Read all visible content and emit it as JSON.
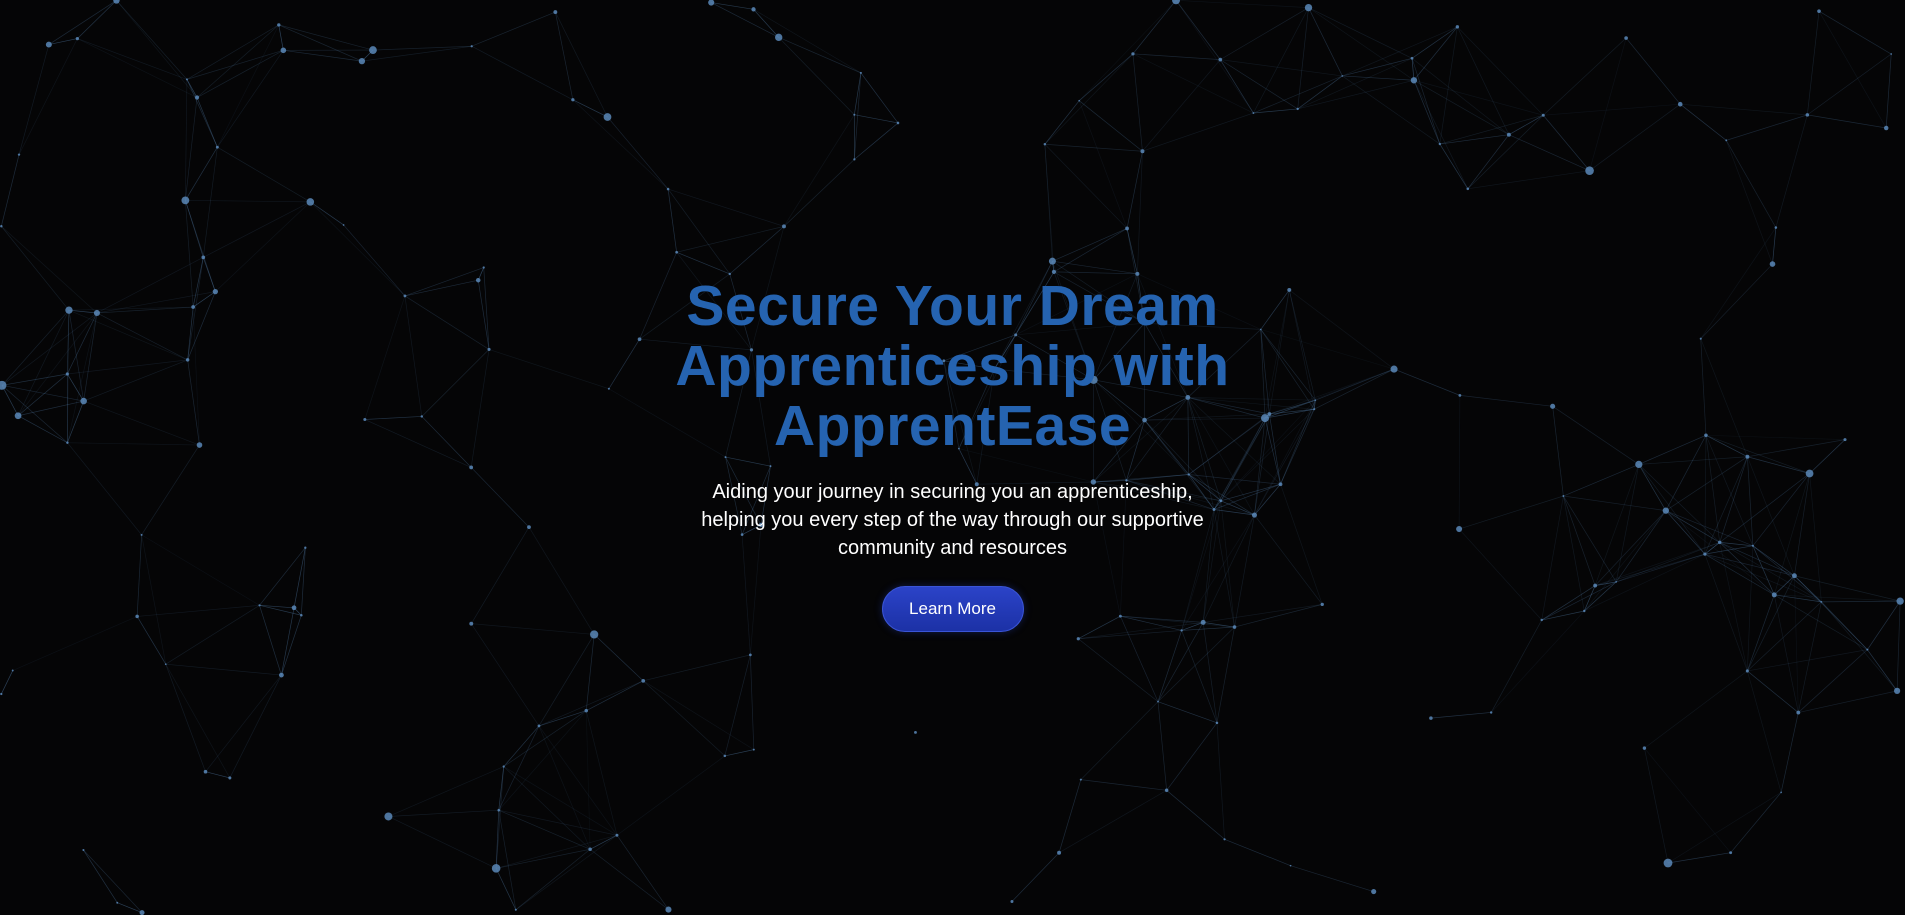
{
  "hero": {
    "title_lines": [
      "Secure Your Dream",
      "Apprenticeship with",
      "ApprentEase"
    ],
    "subtitle_lines": [
      "Aiding your journey in securing you an apprenticeship,",
      "helping you every step of the way through our supportive",
      "community and resources"
    ],
    "cta_label": "Learn More"
  },
  "theme": {
    "background": "#050506",
    "title_color": "#2563b0",
    "network_color": "#5a88b8",
    "button_color": "#2239b8"
  }
}
